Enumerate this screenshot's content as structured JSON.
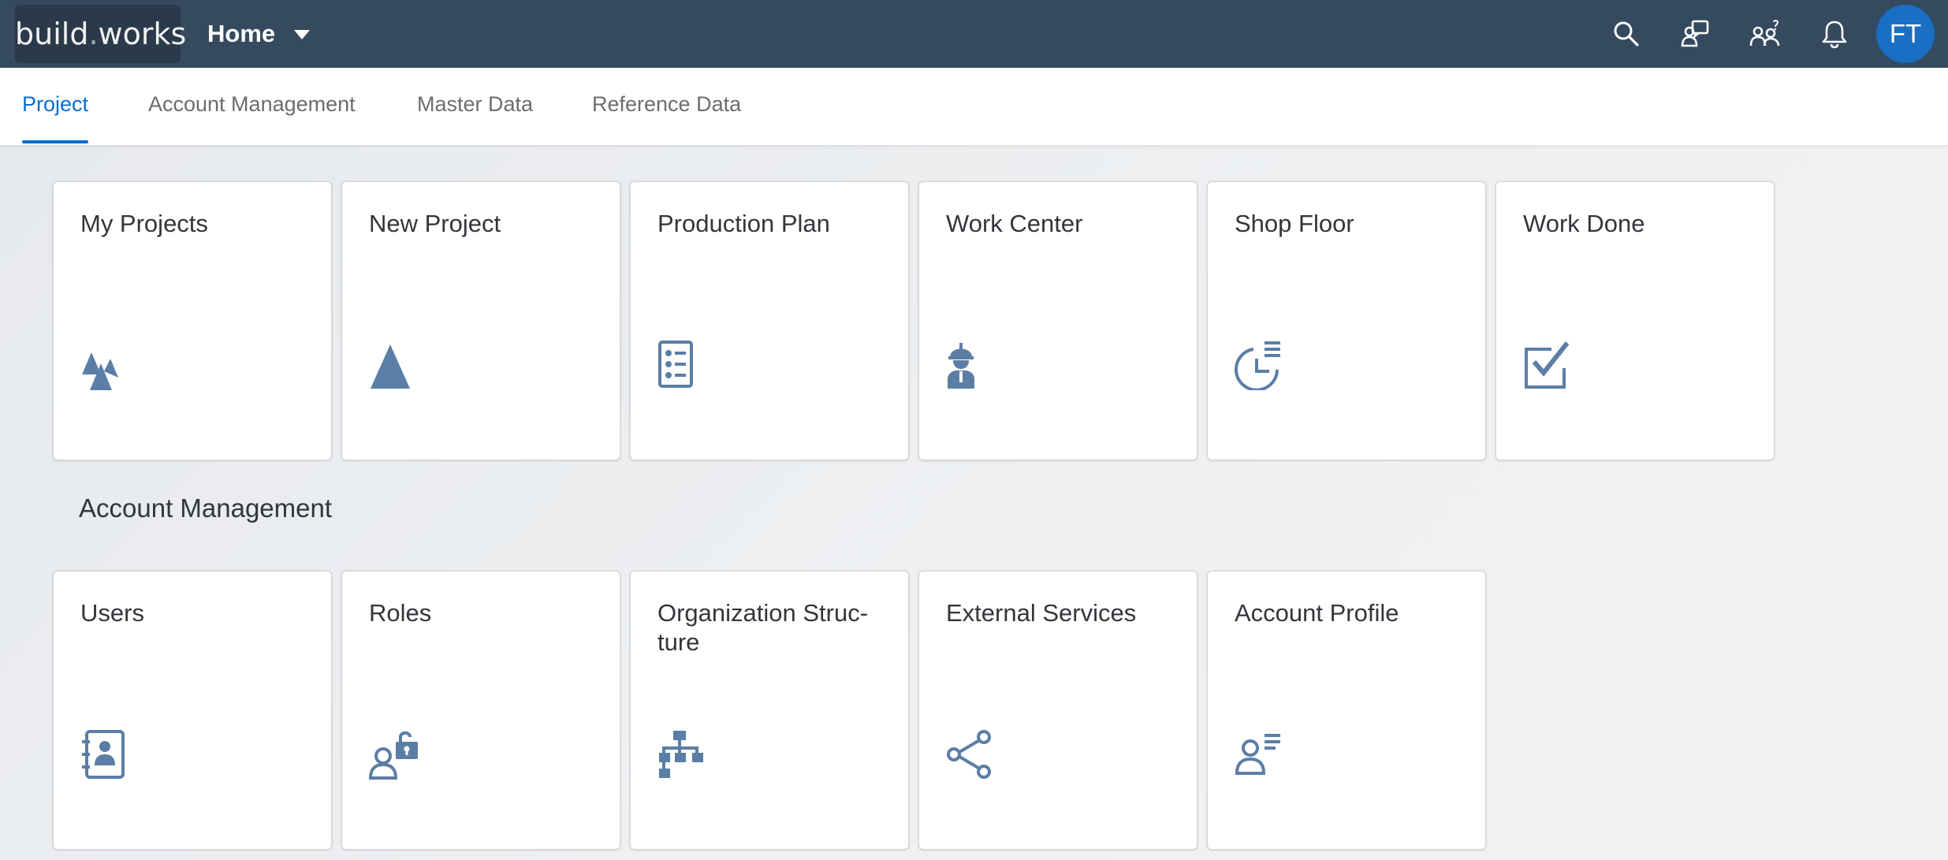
{
  "shell": {
    "logo_main": "build",
    "logo_dot": ".",
    "logo_end": "works",
    "home_label": "Home",
    "avatar_initials": "FT",
    "colors": {
      "bar": "#354a5f",
      "avatar": "#1a6ec4"
    },
    "icons": [
      "search-icon",
      "feedback-icon",
      "team-help-icon",
      "notification-bell-icon"
    ]
  },
  "tabs": [
    {
      "label": "Project",
      "active": true
    },
    {
      "label": "Account Management",
      "active": false
    },
    {
      "label": "Master Data",
      "active": false
    },
    {
      "label": "Reference Data",
      "active": false
    }
  ],
  "groups": {
    "project": {
      "tiles": [
        {
          "title": "My Projects",
          "icon": "mountains-icon"
        },
        {
          "title": "New Project",
          "icon": "triangle-icon"
        },
        {
          "title": "Production Plan",
          "icon": "checklist-icon"
        },
        {
          "title": "Work Center",
          "icon": "worker-icon"
        },
        {
          "title": "Shop Floor",
          "icon": "pie-chart-list-icon"
        },
        {
          "title": "Work Done",
          "icon": "checkbox-icon"
        }
      ]
    },
    "account_management": {
      "title": "Account Management",
      "tiles": [
        {
          "title": "Users",
          "icon": "address-book-icon"
        },
        {
          "title": "Roles",
          "icon": "user-lock-icon"
        },
        {
          "title": "Organization Struc-\nture",
          "icon": "org-chart-icon"
        },
        {
          "title": "External Services",
          "icon": "share-icon"
        },
        {
          "title": "Account Profile",
          "icon": "user-profile-icon"
        }
      ]
    }
  },
  "accent_color": "#0a6ed1",
  "icon_color": "#5b7ea6"
}
